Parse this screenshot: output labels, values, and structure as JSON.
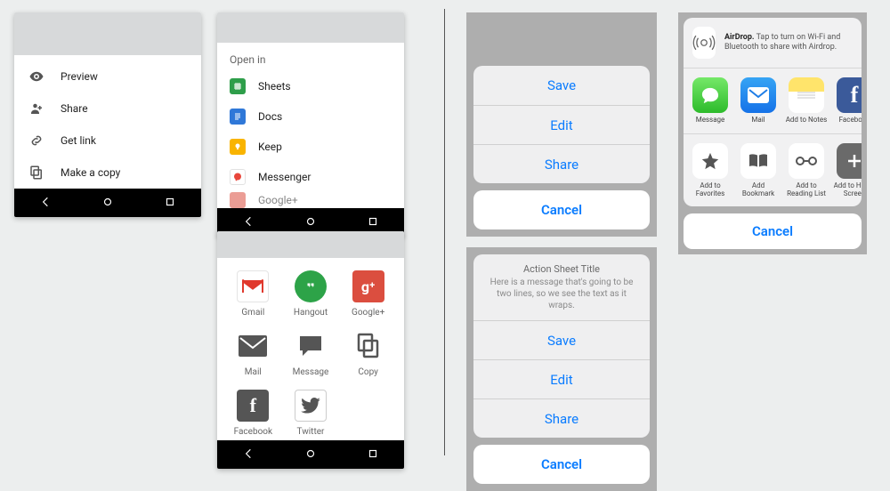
{
  "android": {
    "menu1": {
      "items": [
        {
          "label": "Preview",
          "icon": "eye"
        },
        {
          "label": "Share",
          "icon": "person-plus"
        },
        {
          "label": "Get link",
          "icon": "link"
        },
        {
          "label": "Make a copy",
          "icon": "copy"
        }
      ]
    },
    "menu2": {
      "title": "Open in",
      "items": [
        {
          "label": "Sheets",
          "color": "#2e9e4a"
        },
        {
          "label": "Docs",
          "color": "#2f78d8"
        },
        {
          "label": "Keep",
          "color": "#f9b400"
        },
        {
          "label": "Messenger",
          "color": "#f0493a"
        },
        {
          "label": "Google+",
          "color": "#db4e3f"
        }
      ]
    },
    "grid": {
      "items": [
        {
          "label": "Gmail",
          "icon": "gmail"
        },
        {
          "label": "Hangout",
          "icon": "hangout"
        },
        {
          "label": "Google+",
          "icon": "gplus"
        },
        {
          "label": "Mail",
          "icon": "mail"
        },
        {
          "label": "Message",
          "icon": "message"
        },
        {
          "label": "Copy",
          "icon": "copy"
        },
        {
          "label": "Facebook",
          "icon": "facebook"
        },
        {
          "label": "Twitter",
          "icon": "twitter"
        }
      ]
    }
  },
  "ios": {
    "sheet1": {
      "options": [
        {
          "label": "Save"
        },
        {
          "label": "Edit"
        },
        {
          "label": "Share"
        }
      ],
      "cancel": "Cancel"
    },
    "sheet2": {
      "title": "Action Sheet Title",
      "message": "Here is a message that's going to be two lines, so we see the text as it wraps.",
      "options": [
        {
          "label": "Save"
        },
        {
          "label": "Edit"
        },
        {
          "label": "Share"
        }
      ],
      "cancel": "Cancel"
    },
    "share": {
      "airdrop": {
        "title": "AirDrop.",
        "text": "Tap to turn on Wi-Fi and Bluetooth to share with Airdrop."
      },
      "row1": [
        {
          "label": "Message",
          "icon": "imessage"
        },
        {
          "label": "Mail",
          "icon": "iosmail"
        },
        {
          "label": "Add to Notes",
          "icon": "notes"
        },
        {
          "label": "Facebook",
          "icon": "facebook"
        }
      ],
      "row2": [
        {
          "label": "Add to Favorites",
          "icon": "star"
        },
        {
          "label": "Add Bookmark",
          "icon": "book"
        },
        {
          "label": "Add to Reading List",
          "icon": "glasses"
        },
        {
          "label": "Add to Home Screen",
          "icon": "plus"
        }
      ],
      "cancel": "Cancel"
    }
  }
}
